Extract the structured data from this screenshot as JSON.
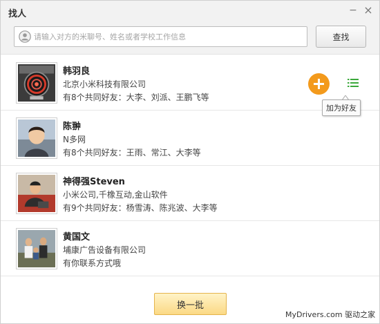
{
  "window": {
    "title": "找人",
    "minimize_glyph": "−",
    "close_glyph": "×"
  },
  "search": {
    "placeholder": "请输入对方的米聊号、姓名或者学校工作信息",
    "button_label": "查找",
    "icon": "user-icon"
  },
  "results": [
    {
      "name": "韩羽良",
      "line1": "北京小米科技有限公司",
      "line2": "有8个共同好友：大李、刘派、王鹏飞等",
      "avatar": "gauge-photo"
    },
    {
      "name": "陈翀",
      "line1": "N多网",
      "line2": "有8个共同好友：王雨、常江、大李等",
      "avatar": "boy-photo"
    },
    {
      "name": "神得强Steven",
      "line1": "小米公司,千橡互动,金山软件",
      "line2": "有9个共同好友：杨雪涛、陈兆波、大李等",
      "avatar": "man-couch-photo"
    },
    {
      "name": "黄国文",
      "line1": "埔康广告设备有限公司",
      "line2": "有你联系方式哦",
      "avatar": "group-photo"
    }
  ],
  "actions": {
    "add_icon": "plus-icon",
    "list_icon": "list-icon",
    "tooltip": "加为好友",
    "accent_orange": "#f39a1c",
    "list_green": "#3aa83a"
  },
  "footer": {
    "refresh_label": "换一批"
  },
  "watermark": "MyDrivers.com 驱动之家"
}
